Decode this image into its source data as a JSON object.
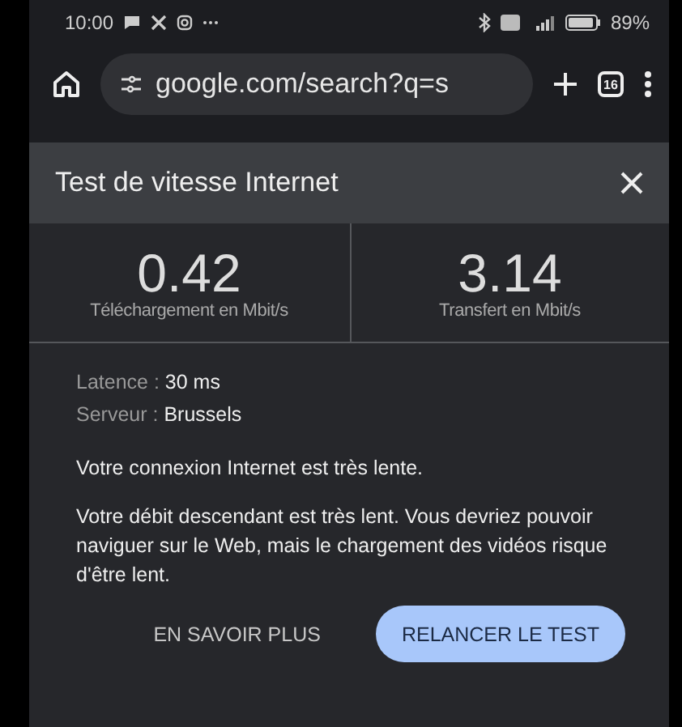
{
  "status_bar": {
    "time": "10:00",
    "battery": "89%"
  },
  "browser": {
    "url": "google.com/search?q=s",
    "tab_count": "16"
  },
  "dialog": {
    "title": "Test de vitesse Internet",
    "results": [
      {
        "value": "0.42",
        "label": "Téléchargement en Mbit/s"
      },
      {
        "value": "3.14",
        "label": "Transfert en Mbit/s"
      }
    ],
    "details": [
      {
        "label": "Latence :",
        "value": "30 ms"
      },
      {
        "label": "Serveur :",
        "value": "Brussels"
      }
    ],
    "summary": "Votre connexion Internet est très lente.",
    "description": "Votre débit descendant est très lent. Vous devriez pouvoir naviguer sur le Web, mais le chargement des vidéos risque d'être lent.",
    "buttons": [
      {
        "label": "EN SAVOIR PLUS",
        "kind": "text"
      },
      {
        "label": "RELANCER LE TEST",
        "kind": "filled"
      }
    ]
  }
}
